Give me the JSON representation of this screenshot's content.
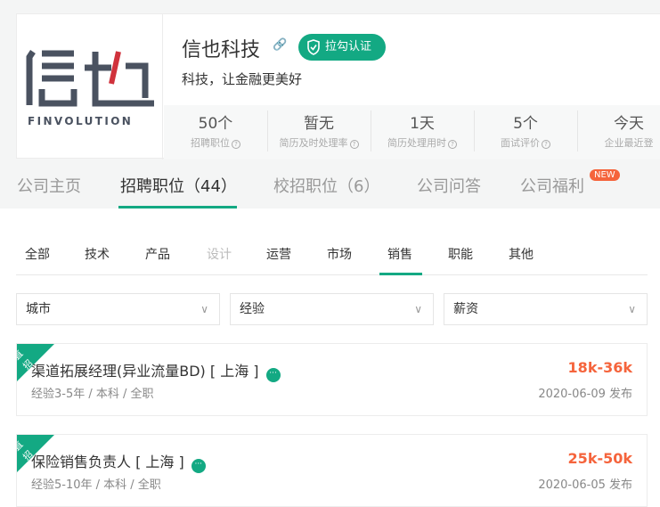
{
  "company": {
    "logo_text": "信也",
    "logo_en": "FINVOLUTION",
    "name": "信也科技",
    "verified": "拉勾认证",
    "slogan": "科技，让金融更美好"
  },
  "stats": [
    {
      "value": "50个",
      "label": "招聘职位"
    },
    {
      "value": "暂无",
      "label": "简历及时处理率"
    },
    {
      "value": "1天",
      "label": "简历处理用时"
    },
    {
      "value": "5个",
      "label": "面试评价"
    },
    {
      "value": "今天",
      "label": "企业最近登"
    }
  ],
  "tabs": [
    {
      "label": "公司主页"
    },
    {
      "label": "招聘职位（44）"
    },
    {
      "label": "校招职位（6）"
    },
    {
      "label": "公司问答"
    },
    {
      "label": "公司福利"
    }
  ],
  "new_badge": "NEW",
  "categories": [
    {
      "label": "全部"
    },
    {
      "label": "技术"
    },
    {
      "label": "产品"
    },
    {
      "label": "设计"
    },
    {
      "label": "运营"
    },
    {
      "label": "市场"
    },
    {
      "label": "销售"
    },
    {
      "label": "职能"
    },
    {
      "label": "其他"
    }
  ],
  "filters": [
    {
      "label": "城市"
    },
    {
      "label": "经验"
    },
    {
      "label": "薪资"
    }
  ],
  "jobs": [
    {
      "badge": "直招",
      "title": "渠道拓展经理(异业流量BD) [ 上海 ]",
      "salary": "18k-36k",
      "meta": "经验3-5年 / 本科 / 全职",
      "date": "2020-06-09 发布"
    },
    {
      "badge": "直招",
      "title": "保险销售负责人 [ 上海 ]",
      "salary": "25k-50k",
      "meta": "经验5-10年 / 本科 / 全职",
      "date": "2020-06-05 发布"
    }
  ],
  "colors": {
    "accent": "#13a983",
    "salary": "#f5643c"
  }
}
